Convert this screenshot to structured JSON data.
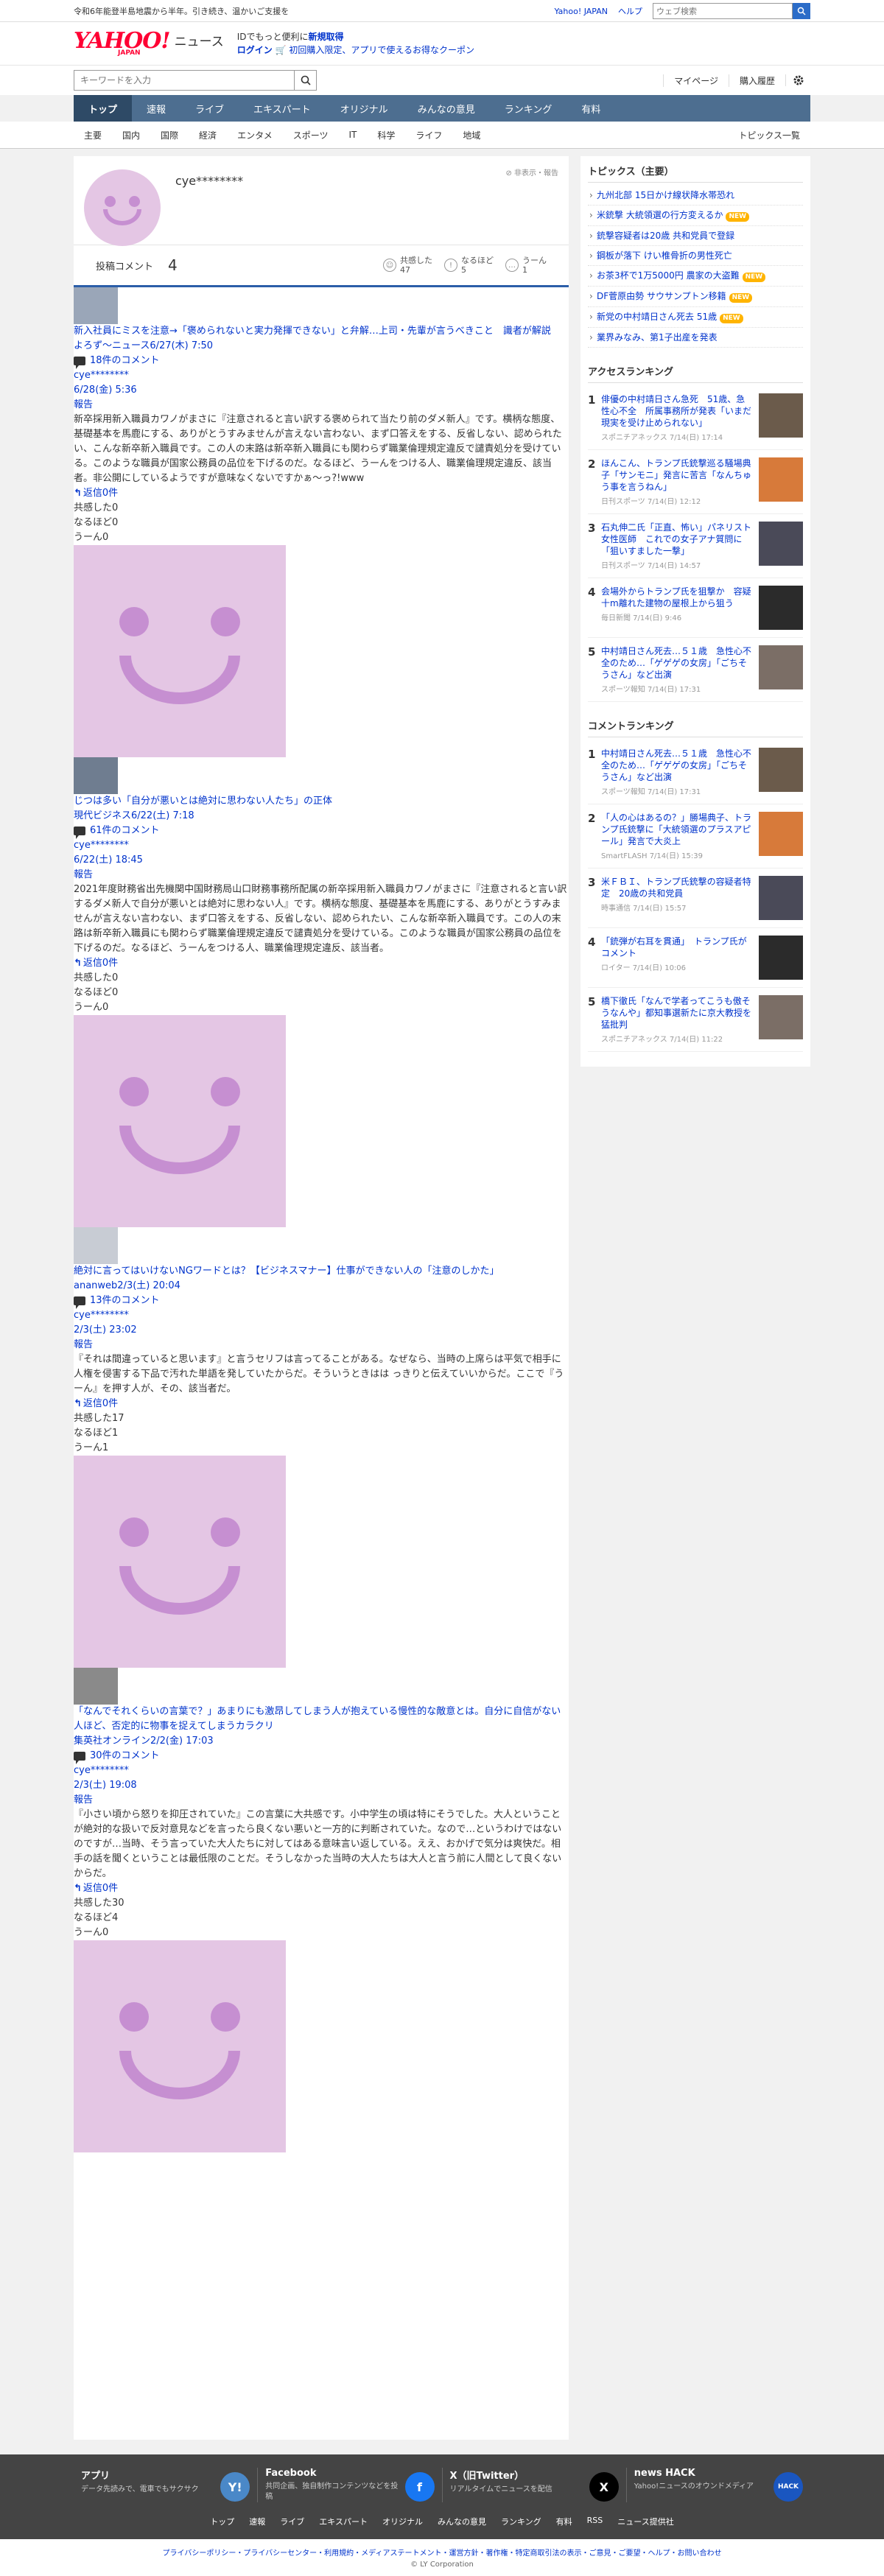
{
  "topbar": {
    "notice": "令和6年能登半島地震から半年。引き続き、温かいご支援を",
    "links": [
      "Yahoo! JAPAN",
      "ヘルプ"
    ],
    "search_placeholder": "ウェブ検索"
  },
  "header": {
    "logo_text": "YAHOO!",
    "logo_sub": "JAPAN",
    "service": "ニュース",
    "promo_line1_pre": "IDでもっと便利に",
    "promo_line1_link": "新規取得",
    "promo_login": "ログイン",
    "promo_line2": "初回購入限定、アプリで使えるお得なクーポン"
  },
  "search": {
    "placeholder": "キーワードを入力",
    "links": [
      "マイページ",
      "購入履歴"
    ]
  },
  "nav": {
    "tabs": [
      "トップ",
      "速報",
      "ライブ",
      "エキスパート",
      "オリジナル",
      "みんなの意見",
      "ランキング",
      "有料"
    ],
    "categories": [
      "主要",
      "国内",
      "国際",
      "経済",
      "エンタメ",
      "スポーツ",
      "IT",
      "科学",
      "ライフ",
      "地域"
    ],
    "topics_list": "トピックス一覧"
  },
  "profile": {
    "username": "cye********",
    "hide_report": "非表示・報告",
    "post_label": "投稿コメント",
    "post_count": "4",
    "reactions": [
      {
        "label": "共感した",
        "count": "47"
      },
      {
        "label": "なるほど",
        "count": "5"
      },
      {
        "label": "うーん",
        "count": "1"
      }
    ]
  },
  "comments": [
    {
      "title": "新入社員にミスを注意→「褒められないと実力発揮できない」と弁解…上司・先輩が言うべきこと　識者が解説",
      "source": "よろず～ニュース6/27(木) 7:50",
      "comment_count": "18件のコメント",
      "user": "cye********",
      "date": "6/28(金) 5:36",
      "report": "報告",
      "body": "新卒採用新入職員カワノがまさに『注意されると言い訳する褒められて当たり前のダメ新人』です。横柄な態度、基礎基本を馬鹿にする、ありがとうすみませんが言えない言わない、まず口答えをする、反省しない、認められたい、こんな新卒新入職員です。この人の末路は新卒新入職員にも関わらず職業倫理規定違反で譴責処分を受けている。このような職員が国家公務員の品位を下げるのだ。なるほど、うーんをつける人、職業倫理規定違反、該当者。非公開にしているようですが意味なくないですかぁ～っ?!www",
      "reply": "返信0件",
      "kyokan": "共感した0",
      "naruhodo": "なるほど0",
      "uun": "うーん0"
    },
    {
      "title": "じつは多い「自分が悪いとは絶対に思わない人たち」の正体",
      "source": "現代ビジネス6/22(土) 7:18",
      "comment_count": "61件のコメント",
      "user": "cye********",
      "date": "6/22(土) 18:45",
      "report": "報告",
      "body": "2021年度財務省出先機関中国財務局山口財務事務所配属の新卒採用新入職員カワノがまさに『注意されると言い訳するダメ新人で自分が悪いとは絶対に思わない人』です。横柄な態度、基礎基本を馬鹿にする、ありがとうすみませんが言えない言わない、まず口答えをする、反省しない、認められたい、こんな新卒新入職員です。この人の末路は新卒新入職員にも関わらず職業倫理規定違反で譴責処分を受けている。このような職員が国家公務員の品位を下げるのだ。なるほど、うーんをつける人、職業倫理規定違反、該当者。",
      "reply": "返信0件",
      "kyokan": "共感した0",
      "naruhodo": "なるほど0",
      "uun": "うーん0"
    },
    {
      "title": "絶対に言ってはいけないNGワードとは？【ビジネスマナー】仕事ができない人の「注意のしかた」",
      "source": "ananweb2/3(土) 20:04",
      "comment_count": "13件のコメント",
      "user": "cye********",
      "date": "2/3(土) 23:02",
      "report": "報告",
      "body": "『それは間違っていると思います』と言うセリフは言ってることがある。なぜなら、当時の上席らは平気で相手に人権を侵害する下品で汚れた単語を発していたからだ。そういうときはは っきりと伝えていいからだ。ここで『うーん』を押す人が、その、該当者だ。",
      "reply": "返信0件",
      "kyokan": "共感した17",
      "naruhodo": "なるほど1",
      "uun": "うーん1"
    },
    {
      "title": "「なんでそれくらいの言葉で？」あまりにも激昂してしまう人が抱えている慢性的な敵意とは。自分に自信がない人ほど、否定的に物事を捉えてしまうカラクリ",
      "source": "集英社オンライン2/2(金) 17:03",
      "comment_count": "30件のコメント",
      "user": "cye********",
      "date": "2/3(土) 19:08",
      "report": "報告",
      "body": "『小さい頃から怒りを抑圧されていた』この言葉に大共感です。小中学生の頃は特にそうでした。大人ということが絶対的な扱いで反対意見などを言ったら良くない悪いと一方的に判断されていた。なので…というわけではないのですが…当時、そう言っていた大人たちに対してはある意味言い返している。ええ、おかげで気分は爽快だ。相手の話を聞くということは最低限のことだ。そうしなかった当時の大人たちは大人と言う前に人間として良くないからだ。",
      "reply": "返信0件",
      "kyokan": "共感した30",
      "naruhodo": "なるほど4",
      "uun": "うーん0"
    }
  ],
  "sidebar": {
    "topics_title": "トピックス（主要）",
    "topics": [
      {
        "text": "九州北部 15日かけ線状降水帯恐れ",
        "new": false
      },
      {
        "text": "米銃撃 大統領選の行方変えるか",
        "new": true
      },
      {
        "text": "銃撃容疑者は20歳 共和党員で登録",
        "new": false
      },
      {
        "text": "鋼板が落下 けい椎骨折の男性死亡",
        "new": false
      },
      {
        "text": "お茶3杯で1万5000円 農家の大盗難",
        "new": true
      },
      {
        "text": "DF菅原由勢 サウサンプトン移籍",
        "new": true
      },
      {
        "text": "新党の中村靖日さん死去 51歳",
        "new": true
      },
      {
        "text": "業界みなみ、第1子出産を発表",
        "new": false
      }
    ],
    "new_label": "NEW",
    "access_title": "アクセスランキング",
    "access": [
      {
        "rank": "1",
        "title": "俳優の中村靖日さん急死　51歳、急性心不全　所属事務所が発表「いまだ現実を受け止められない」",
        "meta": "スポニチアネックス 7/14(日) 17:14"
      },
      {
        "rank": "2",
        "title": "ほんこん、トランプ氏銃撃巡る騒場典子「サンモニ」発言に苦言「なんちゅう事を言うねん」",
        "meta": "日刊スポーツ 7/14(日) 12:12"
      },
      {
        "rank": "3",
        "title": "石丸伸二氏「正直、怖い」パネリスト女性医師　これでの女子アナ質問に「狙いすました一撃」",
        "meta": "日刊スポーツ 7/14(日) 14:57"
      },
      {
        "rank": "4",
        "title": "会場外からトランプ氏を狙撃か　容疑十m離れた建物の屋根上から狙う",
        "meta": "毎日新聞 7/14(日) 9:46"
      },
      {
        "rank": "5",
        "title": "中村靖日さん死去…５１歳　急性心不全のため…「ゲゲゲの女房」「ごちそうさん」など出演",
        "meta": "スポーツ報知 7/14(日) 17:31"
      }
    ],
    "comment_title": "コメントランキング",
    "comment_rank": [
      {
        "rank": "1",
        "title": "中村靖日さん死去…５１歳　急性心不全のため…「ゲゲゲの女房」「ごちそうさん」など出演",
        "meta": "スポーツ報知 7/14(日) 17:31"
      },
      {
        "rank": "2",
        "title": "「人の心はあるの？」勝場典子、トランプ氏銃撃に「大統領選のプラスアピール」発言で大炎上",
        "meta": "SmartFLASH 7/14(日) 15:39"
      },
      {
        "rank": "3",
        "title": "米ＦＢＩ、トランプ氏銃撃の容疑者特定　20歳の共和党員",
        "meta": "時事通信 7/14(日) 15:57"
      },
      {
        "rank": "4",
        "title": "「銃弾が右耳を貫通」　トランプ氏がコメント",
        "meta": "ロイター 7/14(日) 10:06"
      },
      {
        "rank": "5",
        "title": "橋下徹氏「なんで学者ってこうも傲そうなんや」都知事選新たに京大教授を猛批判",
        "meta": "スポニチアネックス 7/14(日) 11:22"
      }
    ]
  },
  "footer": {
    "apps": [
      {
        "name": "アプリ",
        "desc": "データ先読みで、電車でもサクサク",
        "logo": "Y!",
        "color": "#4a88c8"
      },
      {
        "name": "Facebook",
        "desc": "共同企画、独自制作コンテンツなどを投稿",
        "logo": "f",
        "color": "#1877f2"
      },
      {
        "name": "X（旧Twitter）",
        "desc": "リアルタイムでニュースを配信",
        "logo": "X",
        "color": "#000000"
      },
      {
        "name": "news HACK",
        "desc": "Yahoo!ニュースのオウンドメディア",
        "logo": "HACK",
        "color": "#1a56c0"
      }
    ],
    "nav": [
      "トップ",
      "速報",
      "ライブ",
      "エキスパート",
      "オリジナル",
      "みんなの意見",
      "ランキング",
      "有料",
      "RSS",
      "ニュース提供社"
    ],
    "links": "プライバシーポリシー・プライバシーセンター・利用規約・メディアステートメント・運営方針・著作権・特定商取引法の表示・ご意見・ご要望・ヘルプ・お問い合わせ",
    "copyright": "© LY Corporation"
  },
  "colors": {
    "nav_bg": "#4d6e90",
    "link": "#0033cc",
    "brand_red": "#ff0033",
    "avatar_bg": "#e4c6e4",
    "avatar_feature": "#c68fd1"
  }
}
